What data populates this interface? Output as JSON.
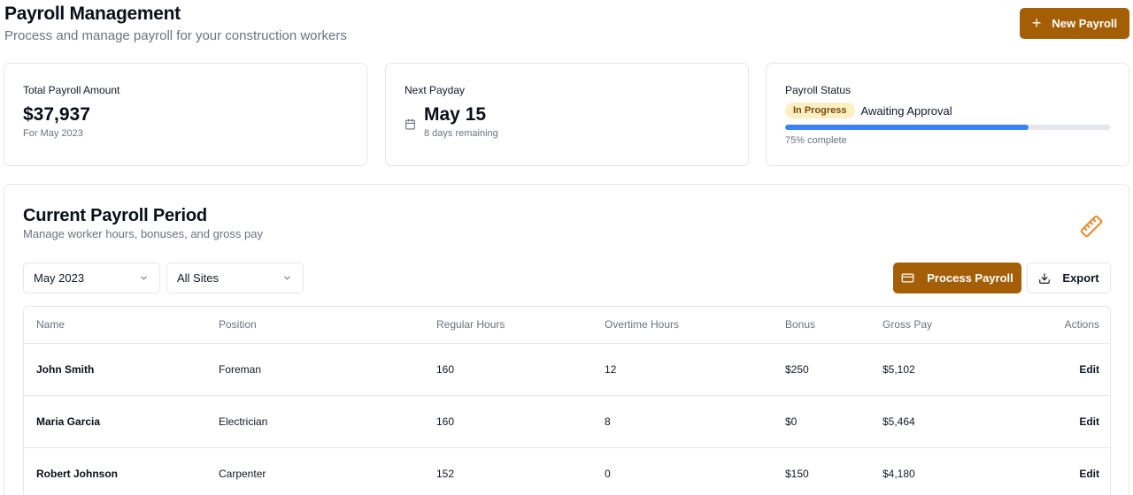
{
  "header": {
    "title": "Payroll Management",
    "subtitle": "Process and manage payroll for your construction workers",
    "new_payroll_label": "New Payroll"
  },
  "cards": {
    "total": {
      "label": "Total Payroll Amount",
      "value": "$37,937",
      "sub": "For May 2023"
    },
    "payday": {
      "label": "Next Payday",
      "value": "May 15",
      "sub": "8 days remaining"
    },
    "status": {
      "label": "Payroll Status",
      "badge": "In Progress",
      "text": "Awaiting Approval",
      "progress": 75,
      "progress_label": "75% complete"
    }
  },
  "period": {
    "title": "Current Payroll Period",
    "subtitle": "Manage worker hours, bonuses, and gross pay",
    "month_select": "May 2023",
    "site_select": "All Sites",
    "process_label": "Process Payroll",
    "export_label": "Export"
  },
  "table": {
    "columns": [
      "Name",
      "Position",
      "Regular Hours",
      "Overtime Hours",
      "Bonus",
      "Gross Pay",
      "Actions"
    ],
    "rows": [
      {
        "name": "John Smith",
        "position": "Foreman",
        "regular": "160",
        "overtime": "12",
        "bonus": "$250",
        "gross": "$5,102",
        "action": "Edit"
      },
      {
        "name": "Maria Garcia",
        "position": "Electrician",
        "regular": "160",
        "overtime": "8",
        "bonus": "$0",
        "gross": "$5,464",
        "action": "Edit"
      },
      {
        "name": "Robert Johnson",
        "position": "Carpenter",
        "regular": "152",
        "overtime": "0",
        "bonus": "$150",
        "gross": "$4,180",
        "action": "Edit"
      }
    ]
  },
  "colors": {
    "accent": "#a45f06",
    "progress": "#3b82f6",
    "badge_bg": "#fcf0c3",
    "badge_text": "#7a4a09"
  },
  "icons": {
    "new_payroll": "plus-icon",
    "payday": "calendar-icon",
    "panel": "ruler-icon",
    "select": "chevron-down-icon",
    "process": "credit-card-icon",
    "export": "download-icon"
  }
}
